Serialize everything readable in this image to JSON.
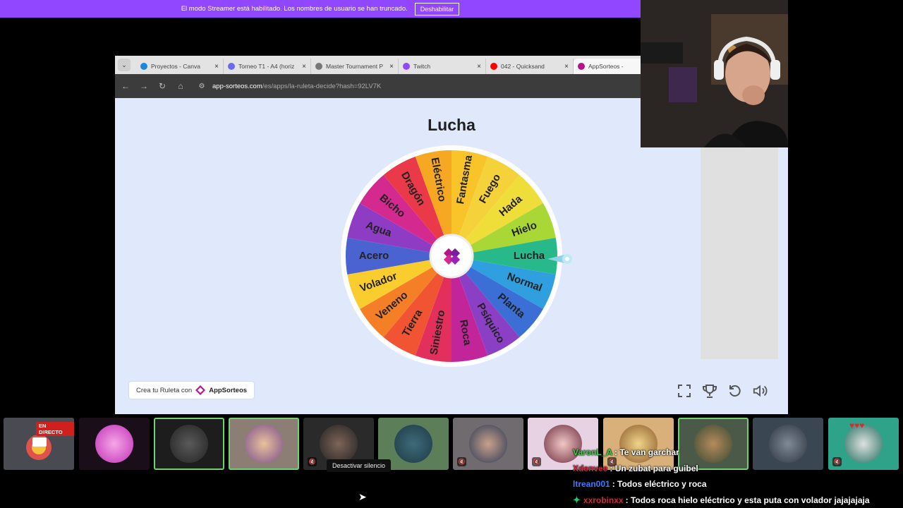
{
  "banner": {
    "text": "El modo Streamer está habilitado. Los nombres de usuario se han truncado.",
    "button": "Deshabilitar"
  },
  "browser": {
    "tabs": [
      {
        "label": "Proyectos - Canva",
        "color": "#1a88e0"
      },
      {
        "label": "Torneo T1 - A4 (horiz",
        "color": "#6a6af0"
      },
      {
        "label": "Master Tournament P",
        "color": "#777777"
      },
      {
        "label": "Twitch",
        "color": "#9146ff"
      },
      {
        "label": "042 - Quicksand",
        "color": "#ff0000"
      },
      {
        "label": "AppSorteos -",
        "color": "#b4148c"
      }
    ],
    "url_host": "app-sorteos.com",
    "url_path": "/es/apps/la-ruleta-decide?hash=92LV7K"
  },
  "wheel": {
    "title": "Lucha",
    "segments": [
      {
        "label": "Eléctrico",
        "color": "#f7a823"
      },
      {
        "label": "Fantasma",
        "color": "#f8c42a"
      },
      {
        "label": "Fuego",
        "color": "#f5d23a"
      },
      {
        "label": "Hada",
        "color": "#efde3a"
      },
      {
        "label": "Hielo",
        "color": "#a9d735"
      },
      {
        "label": "Lucha",
        "color": "#28b98a"
      },
      {
        "label": "Normal",
        "color": "#2f9fe0"
      },
      {
        "label": "Planta",
        "color": "#3b6fd6"
      },
      {
        "label": "Psíquico",
        "color": "#8b3fc4"
      },
      {
        "label": "Roca",
        "color": "#c2259a"
      },
      {
        "label": "Siniestro",
        "color": "#e32f5c"
      },
      {
        "label": "Tierra",
        "color": "#f05433"
      },
      {
        "label": "Veneno",
        "color": "#f57f27"
      },
      {
        "label": "Volador",
        "color": "#f9cd2e"
      },
      {
        "label": "Acero",
        "color": "#4a63d0"
      },
      {
        "label": "Agua",
        "color": "#8f3cc5"
      },
      {
        "label": "Bicho",
        "color": "#d42a8f"
      },
      {
        "label": "Dragón",
        "color": "#ea3a4a"
      }
    ]
  },
  "credit": {
    "prefix": "Crea tu Ruleta con",
    "brand": "AppSorteos"
  },
  "strip": {
    "live_badge": "EN DIRECTO",
    "tooltip": "Desactivar silencio"
  },
  "chat": [
    {
      "name": "VaronL_A",
      "name_color": "#3ecf4a",
      "text": ": Te van garchar"
    },
    {
      "name": "Xdenvee",
      "name_color": "#d0283a",
      "text": ": Un zubat para guibel"
    },
    {
      "name": "ltrean001",
      "name_color": "#3e7bff",
      "text": ": Todos eléctrico y roca"
    },
    {
      "name": "xxrobinxx",
      "name_color": "#d0283a",
      "text": ": Todos roca hielo eléctrico y esta puta con volador jajajajaja",
      "badge": "✦"
    }
  ]
}
